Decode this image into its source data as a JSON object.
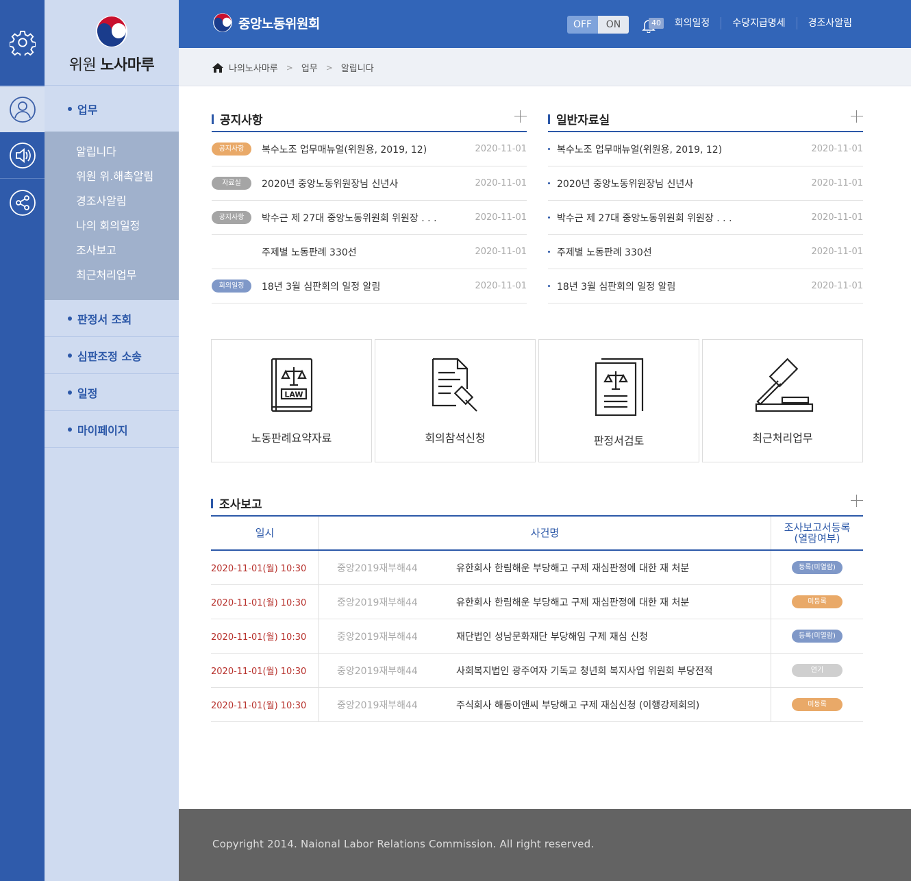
{
  "brand": {
    "prefix": "위원",
    "name": "노사마루"
  },
  "header": {
    "site_name": "중앙노동위원회",
    "toggle_off": "OFF",
    "toggle_on": "ON",
    "notification_count": "40",
    "links": [
      "회의일정",
      "수당지급명세",
      "경조사알림"
    ]
  },
  "breadcrumb": [
    "나의노사마루",
    "업무",
    "알립니다"
  ],
  "sidebar": {
    "active_section": "업무",
    "submenu": [
      "알립니다",
      "위원 위.해촉알림",
      "경조사알림",
      "나의 회의일정",
      "조사보고",
      "최근처리업무"
    ],
    "sections": [
      "판정서 조회",
      "심판조정 소송",
      "일정",
      "마이페이지"
    ]
  },
  "notice": {
    "title": "공지사항",
    "items": [
      {
        "tag": "공지사항",
        "tag_color": "#e9a968",
        "title": "복수노조 업무매뉴얼(위원용, 2019, 12)",
        "date": "2020-11-01"
      },
      {
        "tag": "자료실",
        "tag_color": "#a5a5a5",
        "title": "2020년 중앙노동위원장님 신년사",
        "date": "2020-11-01"
      },
      {
        "tag": "공지사항",
        "tag_color": "#a5a5a5",
        "title": "박수근 제 27대 중앙노동위원회 위원장 . . .",
        "date": "2020-11-01"
      },
      {
        "tag": "",
        "tag_color": "",
        "title": "주제별 노동판례 330선",
        "date": "2020-11-01"
      },
      {
        "tag": "회의일정",
        "tag_color": "#7f98c8",
        "title": "18년 3월 심판회의 일정 알림",
        "date": "2020-11-01"
      }
    ]
  },
  "library": {
    "title": "일반자료실",
    "items": [
      {
        "title": "복수노조 업무매뉴얼(위원용, 2019, 12)",
        "date": "2020-11-01"
      },
      {
        "title": "2020년 중앙노동위원장님 신년사",
        "date": "2020-11-01"
      },
      {
        "title": "박수근 제 27대 중앙노동위원회 위원장 . . .",
        "date": "2020-11-01"
      },
      {
        "title": "주제별 노동판례 330선",
        "date": "2020-11-01"
      },
      {
        "title": "18년 3월 심판회의 일정 알림",
        "date": "2020-11-01"
      }
    ]
  },
  "tiles": [
    {
      "label": "노동판례요약자료",
      "icon": "law-book-icon",
      "icon_text": "LAW"
    },
    {
      "label": "회의참석신청",
      "icon": "document-gavel-icon"
    },
    {
      "label": "판정서검토",
      "icon": "scales-document-icon"
    },
    {
      "label": "최근처리업무",
      "icon": "gavel-icon"
    }
  ],
  "report": {
    "title": "조사보고",
    "columns": [
      "일시",
      "사건명",
      "조사보고서등록\n(열람여부)"
    ],
    "rows": [
      {
        "datetime": "2020-11-01(월) 10:30",
        "case_no": "중앙2019재부해44",
        "case_name": "유한회사 한림해운 부당해고 구제 재심판정에 대한 재 처분",
        "status": "등록(미열람)",
        "status_color": "#7f98c8"
      },
      {
        "datetime": "2020-11-01(월) 10:30",
        "case_no": "중앙2019재부해44",
        "case_name": "유한회사 한림해운 부당해고 구제 재심판정에 대한 재 처분",
        "status": "미등록",
        "status_color": "#e9a968"
      },
      {
        "datetime": "2020-11-01(월) 10:30",
        "case_no": "중앙2019재부해44",
        "case_name": "재단법인 성남문화재단 부당해임 구제 재심 신청",
        "status": "등록(미열람)",
        "status_color": "#7f98c8"
      },
      {
        "datetime": "2020-11-01(월) 10:30",
        "case_no": "중앙2019재부해44",
        "case_name": "사회복지법인 광주여자 기독교 청년회 복지사업 위원회 부당전적",
        "status": "연기",
        "status_color": "#cfcfcf"
      },
      {
        "datetime": "2020-11-01(월) 10:30",
        "case_no": "중앙2019재부해44",
        "case_name": "주식회사 해동이앤씨 부당해고 구제 재심신청 (이행강제회의)",
        "status": "미등록",
        "status_color": "#e9a968"
      }
    ]
  },
  "footer": {
    "copyright": "Copyright 2014. Naional Labor Relations Commission. All right reserved."
  }
}
